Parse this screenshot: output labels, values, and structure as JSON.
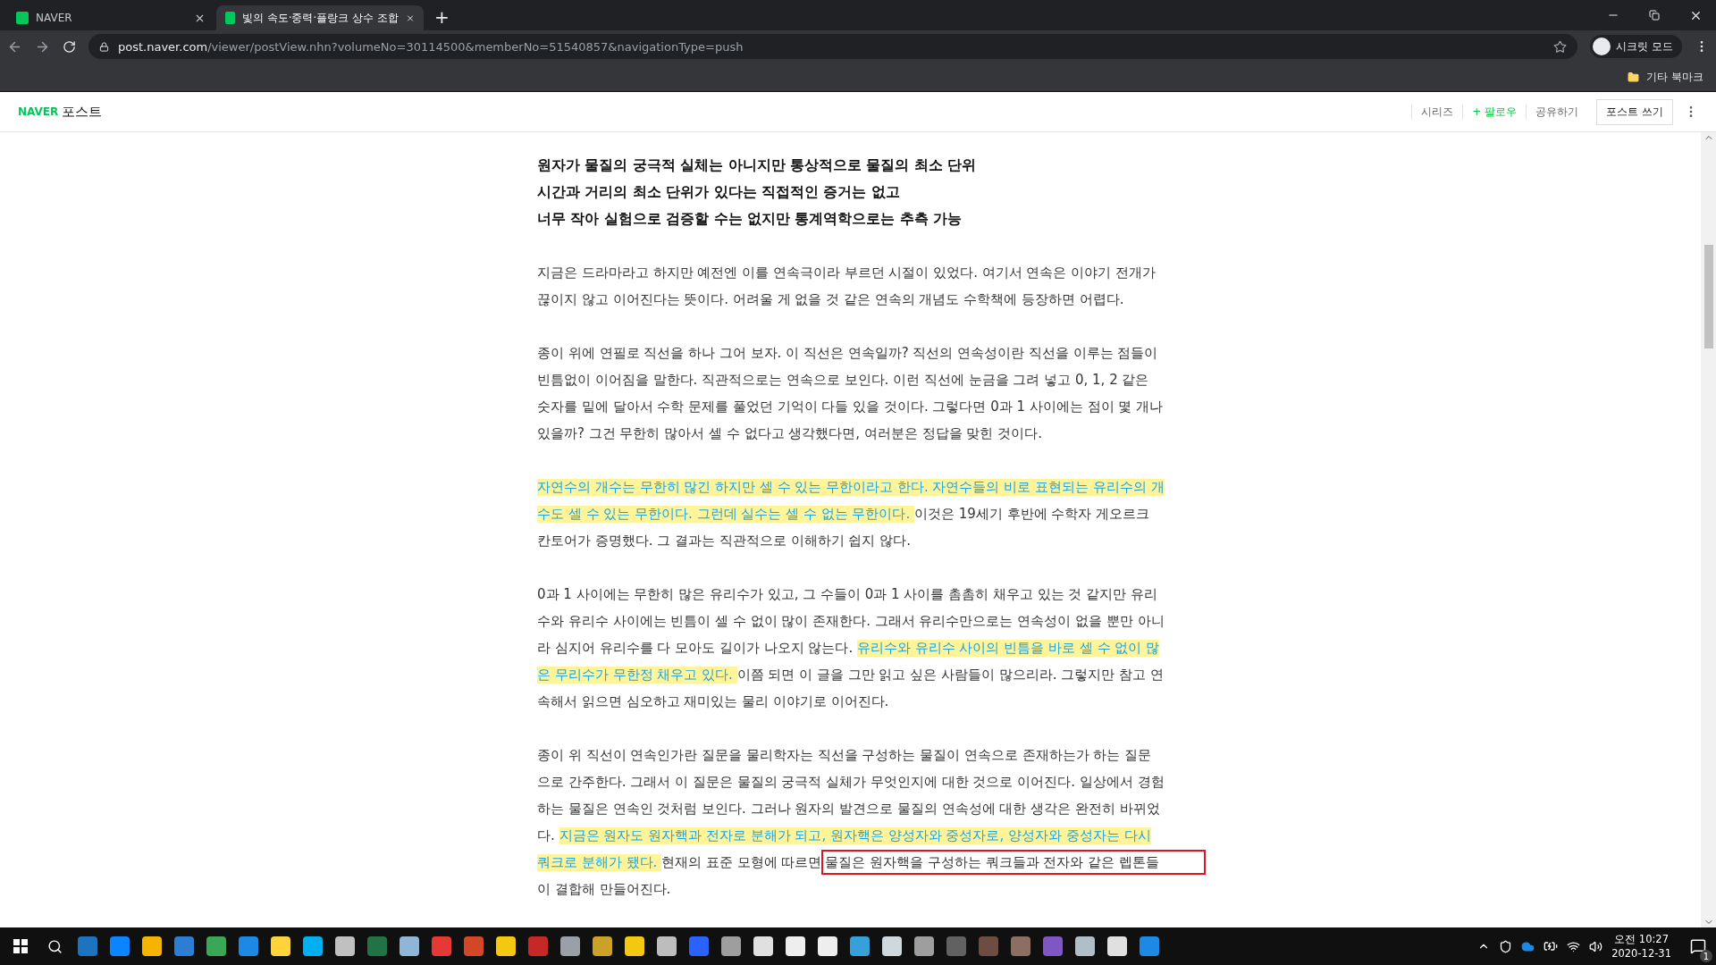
{
  "browser": {
    "tabs": [
      {
        "title": "NAVER",
        "selected": false
      },
      {
        "title": "빛의 속도·중력·플랑크 상수 조합",
        "selected": true
      }
    ],
    "new_tab": "+",
    "url_host": "post.naver.com",
    "url_path": "/viewer/postView.nhn?volumeNo=30114500&memberNo=51540857&navigationType=push",
    "profile": "시크릿 모드",
    "bookmarks_folder": "기타 북마크"
  },
  "header": {
    "logo": "NAVER",
    "service": "포스트",
    "links": [
      {
        "label": "시리즈",
        "kind": "plain"
      },
      {
        "label": "+ 팔로우",
        "kind": "follow"
      },
      {
        "label": "공유하기",
        "kind": "plain"
      }
    ],
    "write_button": "포스트 쓰기"
  },
  "article": {
    "lead": [
      "원자가 물질의 궁극적 실체는 아니지만 통상적으로 물질의 최소 단위",
      "시간과 거리의 최소 단위가 있다는 직접적인 증거는 없고",
      "너무 작아 실험으로 검증할 수는 없지만 통계역학으로는 추측 가능"
    ],
    "paragraphs": [
      {
        "lines": [
          [
            {
              "kind": "plain",
              "text": "지금은 드라마라고 하지만 예전엔 이를 연속극이라 부르던 시절이 있었다. 여기서 연속은 이야기 전개가"
            }
          ],
          [
            {
              "kind": "plain",
              "text": "끊이지 않고 이어진다는 뜻이다. 어려울 게 없을 것 같은 연속의 개념도 수학책에 등장하면 어렵다."
            }
          ]
        ]
      },
      {
        "lines": [
          [
            {
              "kind": "plain",
              "text": "종이 위에 연필로 직선을 하나 그어 보자. 이 직선은 연속일까? 직선의 연속성이란 직선을 이루는 점들이"
            }
          ],
          [
            {
              "kind": "plain",
              "text": "빈틈없이 이어짐을 말한다. 직관적으로는 연속으로 보인다. 이런 직선에 눈금을 그려 넣고 0, 1, 2 같은"
            }
          ],
          [
            {
              "kind": "plain",
              "text": "숫자를 밑에 달아서 수학 문제를 풀었던 기억이 다들 있을 것이다. 그렇다면 0과 1 사이에는 점이 몇 개나"
            }
          ],
          [
            {
              "kind": "plain",
              "text": "있을까? 그건 무한히 많아서 셀 수 없다고 생각했다면, 여러분은 정답을 맞힌 것이다."
            }
          ]
        ]
      },
      {
        "lines": [
          [
            {
              "kind": "highlight",
              "text": "자연수의 개수는 무한히 많긴 하지만 셀 수 있는 무한이라고 한다. 자연수들의 비로 표현되는 유리수의 개"
            }
          ],
          [
            {
              "kind": "highlight",
              "text": "수도 셀 수 있는 무한이다. 그런데 실수는 셀 수 없는 무한이다. "
            },
            {
              "kind": "plain",
              "text": "이것은 19세기 후반에 수학자 게오르크"
            }
          ],
          [
            {
              "kind": "plain",
              "text": "칸토어가 증명했다. 그 결과는 직관적으로 이해하기 쉽지 않다."
            }
          ]
        ]
      },
      {
        "lines": [
          [
            {
              "kind": "plain",
              "text": "0과 1 사이에는 무한히 많은 유리수가 있고, 그 수들이 0과 1 사이를 촘촘히 채우고 있는 것 같지만 유리"
            }
          ],
          [
            {
              "kind": "plain",
              "text": "수와 유리수 사이에는 빈틈이 셀 수 없이 많이 존재한다. 그래서 유리수만으로는 연속성이 없을 뿐만 아니"
            }
          ],
          [
            {
              "kind": "plain",
              "text": "라 심지어 유리수를 다 모아도 길이가 나오지 않는다. "
            },
            {
              "kind": "highlight",
              "text": "유리수와 유리수 사이의 빈틈을 바로 셀 수 없이 많"
            }
          ],
          [
            {
              "kind": "highlight",
              "text": "은 무리수가 무한정 채우고 있다. "
            },
            {
              "kind": "plain",
              "text": "이쯤 되면 이 글을 그만 읽고 싶은 사람들이 많으리라. 그렇지만 참고 연"
            }
          ],
          [
            {
              "kind": "plain",
              "text": "속해서 읽으면 심오하고 재미있는 물리 이야기로 이어진다."
            }
          ]
        ]
      },
      {
        "lines": [
          [
            {
              "kind": "plain",
              "text": "종이 위 직선이 연속인가란 질문을 물리학자는 직선을 구성하는 물질이 연속으로 존재하는가 하는 질문"
            }
          ],
          [
            {
              "kind": "plain",
              "text": "으로 간주한다. 그래서 이 질문은 물질의 궁극적 실체가 무엇인지에 대한 것으로 이어진다. 일상에서 경험"
            }
          ],
          [
            {
              "kind": "plain",
              "text": "하는 물질은 연속인 것처럼 보인다. 그러나 원자의 발견으로 물질의 연속성에 대한 생각은 완전히 바뀌었"
            }
          ],
          [
            {
              "kind": "plain",
              "text": "다. "
            },
            {
              "kind": "highlight",
              "text": "지금은 원자도 원자핵과 전자로 분해가 되고, 원자핵은 양성자와 중성자로, 양성자와 중성자는 다시"
            }
          ],
          [
            {
              "kind": "highlight",
              "text": "쿼크로 분해가 됐다. "
            },
            {
              "kind": "plain",
              "text": "현재의 표준 모형에 따르면"
            },
            {
              "kind": "boxed",
              "text": "물질은 원자핵을 구성하는 쿼크들과 전자와 같은 렙톤들"
            }
          ],
          [
            {
              "kind": "plain",
              "text": "이 결합해 만들어진다."
            }
          ]
        ]
      }
    ]
  },
  "taskbar": {
    "time": "오전 10:27",
    "date": "2020-12-31",
    "notifications": "1"
  }
}
